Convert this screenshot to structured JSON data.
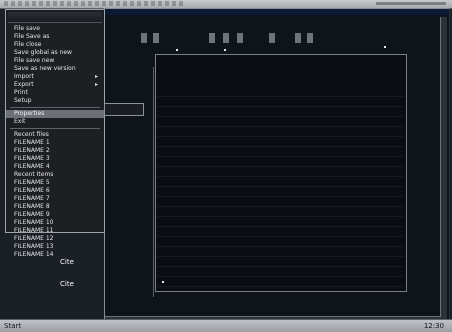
{
  "menu": {
    "items": [
      {
        "label": "File save",
        "has_submenu": false
      },
      {
        "label": "File Save as",
        "has_submenu": false
      },
      {
        "label": "File close",
        "has_submenu": false
      },
      {
        "label": "Save global as new",
        "has_submenu": false
      },
      {
        "label": "File save new",
        "has_submenu": false
      },
      {
        "label": "Save as new version",
        "has_submenu": false
      },
      {
        "label": "Import",
        "has_submenu": true
      },
      {
        "label": "Export",
        "has_submenu": true
      },
      {
        "label": "Print",
        "has_submenu": false
      },
      {
        "label": "Setup",
        "has_submenu": false
      },
      {
        "label": "",
        "separator": true
      },
      {
        "label": "Properties",
        "has_submenu": false,
        "selected": true
      },
      {
        "label": "Exit",
        "has_submenu": false
      },
      {
        "label": "",
        "separator": true
      },
      {
        "label": "Recent files",
        "has_submenu": false
      },
      {
        "label": "FILENAME 1",
        "has_submenu": false
      },
      {
        "label": "FILENAME 2",
        "has_submenu": false
      },
      {
        "label": "FILENAME 3",
        "has_submenu": false
      },
      {
        "label": "FILENAME 4",
        "has_submenu": false
      },
      {
        "label": "Recent Items",
        "has_submenu": false
      },
      {
        "label": "FILENAME 5",
        "has_submenu": false
      },
      {
        "label": "FILENAME 6",
        "has_submenu": false
      },
      {
        "label": "FILENAME 7",
        "has_submenu": false
      },
      {
        "label": "FILENAME 8",
        "has_submenu": false
      },
      {
        "label": "FILENAME 9",
        "has_submenu": false
      },
      {
        "label": "FILENAME 10",
        "has_submenu": false
      },
      {
        "label": "FILENAME 11",
        "has_submenu": false
      },
      {
        "label": "FILENAME 12",
        "has_submenu": false
      },
      {
        "label": "FILENAME 13",
        "has_submenu": false
      },
      {
        "label": "FILENAME 14",
        "has_submenu": false
      }
    ]
  },
  "bottom": {
    "label_top": "Cite",
    "label_bottom": "Cite",
    "taskbar_start": "Start",
    "clock": "12:30"
  },
  "colors": {
    "menu_selected": "#6a6f78"
  }
}
